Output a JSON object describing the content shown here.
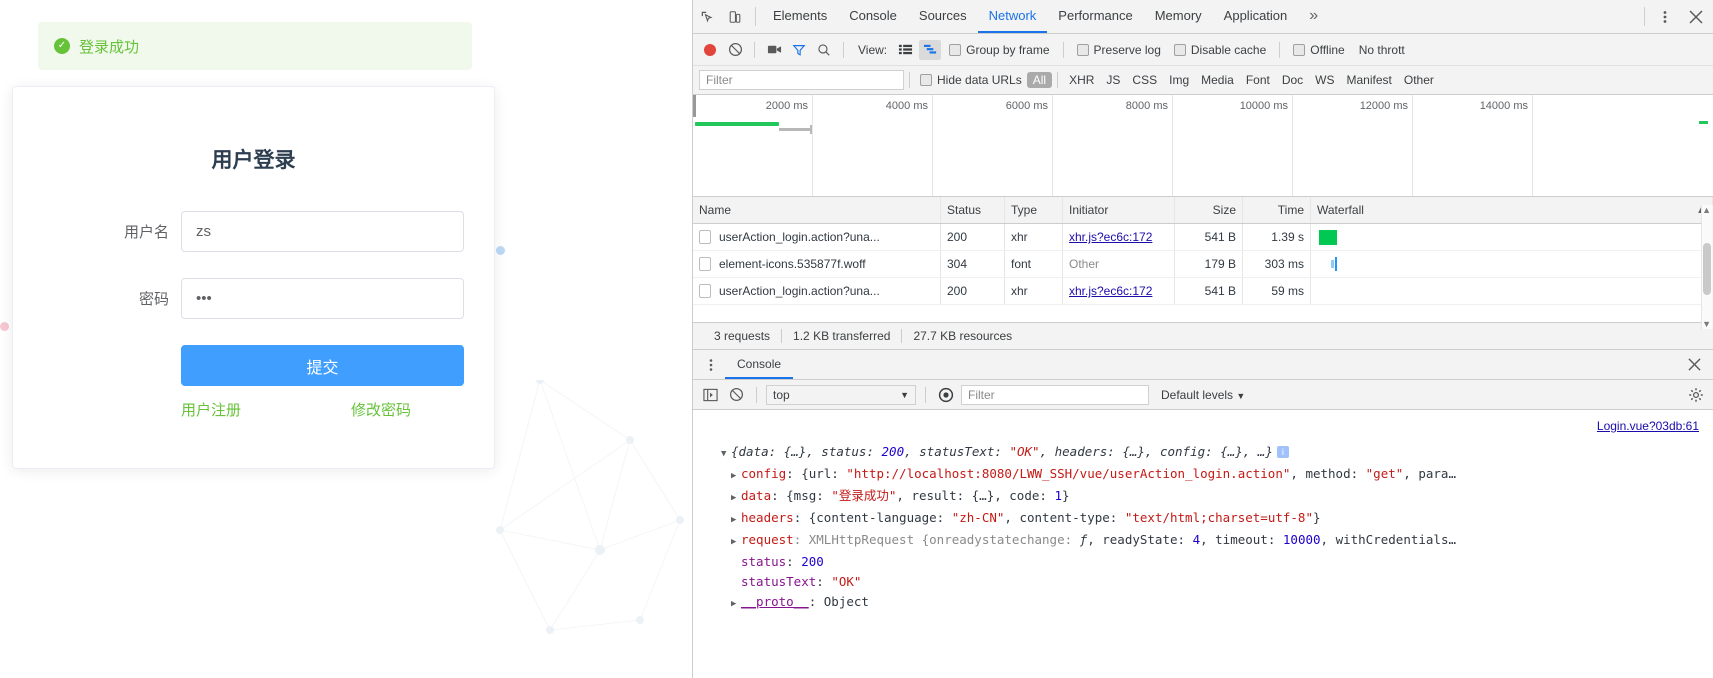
{
  "webpage": {
    "alert": {
      "icon": "check-circle-icon",
      "text": "登录成功"
    },
    "login_card": {
      "title": "用户登录",
      "fields": [
        {
          "label": "用户名",
          "value": "zs",
          "placeholder": "",
          "type": "text"
        },
        {
          "label": "密码",
          "value": "•••",
          "placeholder": "",
          "type": "password"
        }
      ],
      "submit_label": "提交",
      "links": [
        {
          "label": "用户注册"
        },
        {
          "label": "修改密码"
        }
      ]
    },
    "colors": {
      "success": "#67c23a",
      "primary": "#409eff",
      "alert_bg": "#f0f9eb"
    }
  },
  "devtools": {
    "tabs": [
      {
        "label": "Elements",
        "active": false
      },
      {
        "label": "Console",
        "active": false
      },
      {
        "label": "Sources",
        "active": false
      },
      {
        "label": "Network",
        "active": true
      },
      {
        "label": "Performance",
        "active": false
      },
      {
        "label": "Memory",
        "active": false
      },
      {
        "label": "Application",
        "active": false
      }
    ],
    "tabs_overflow": "»",
    "more_menu_icon": "kebab-menu-icon",
    "close_icon": "close-icon",
    "inspect_icon": "inspect-element-icon",
    "device_icon": "device-toolbar-icon",
    "network_toolbar": {
      "record_icon": "record-stop-icon",
      "clear_icon": "clear-no-entry-icon",
      "screenshot_icon": "camera-icon",
      "filter_icon": "funnel-icon",
      "search_icon": "search-icon",
      "view_label": "View:",
      "view_list_icon": "list-view-icon",
      "view_waterfall_icon": "waterfall-view-icon",
      "group_by_frame": "Group by frame",
      "preserve_log": "Preserve log",
      "disable_cache": "Disable cache",
      "offline": "Offline",
      "throttle": "No thrott"
    },
    "filter_bar": {
      "filter_placeholder": "Filter",
      "filter_value": "",
      "hide_data_urls": "Hide data URLs",
      "types": [
        {
          "label": "All",
          "active": true
        },
        {
          "label": "XHR",
          "active": false
        },
        {
          "label": "JS",
          "active": false
        },
        {
          "label": "CSS",
          "active": false
        },
        {
          "label": "Img",
          "active": false
        },
        {
          "label": "Media",
          "active": false
        },
        {
          "label": "Font",
          "active": false
        },
        {
          "label": "Doc",
          "active": false
        },
        {
          "label": "WS",
          "active": false
        },
        {
          "label": "Manifest",
          "active": false
        },
        {
          "label": "Other",
          "active": false
        }
      ]
    },
    "timeline": {
      "ticks": [
        "2000 ms",
        "4000 ms",
        "6000 ms",
        "8000 ms",
        "10000 ms",
        "12000 ms",
        "14000 ms"
      ]
    },
    "table": {
      "columns": [
        "Name",
        "Status",
        "Type",
        "Initiator",
        "Size",
        "Time",
        "Waterfall"
      ],
      "rows": [
        {
          "name": "userAction_login.action?una...",
          "status": "200",
          "type": "xhr",
          "initiator": "xhr.js?ec6c:172",
          "initiator_is_link": true,
          "size": "541 B",
          "time": "1.39 s"
        },
        {
          "name": "element-icons.535877f.woff",
          "status": "304",
          "type": "font",
          "initiator": "Other",
          "initiator_is_link": false,
          "size": "179 B",
          "time": "303 ms"
        },
        {
          "name": "userAction_login.action?una...",
          "status": "200",
          "type": "xhr",
          "initiator": "xhr.js?ec6c:172",
          "initiator_is_link": true,
          "size": "541 B",
          "time": "59 ms"
        }
      ]
    },
    "summary": {
      "requests": "3 requests",
      "transferred": "1.2 KB transferred",
      "resources": "27.7 KB resources"
    },
    "drawer": {
      "tab": "Console",
      "kebab_icon": "kebab-menu-icon",
      "close_icon": "close-icon",
      "toolbar": {
        "sidebar_icon": "show-sidebar-icon",
        "clear_icon": "clear-console-icon",
        "context": "top",
        "eye_icon": "live-expression-eye-icon",
        "filter_placeholder": "Filter",
        "filter_value": "",
        "levels": "Default levels",
        "settings_icon": "gear-icon"
      },
      "source_link": "Login.vue?03db:61",
      "log": {
        "line1_prefix": "{data: {…}, status: ",
        "line1_status": "200",
        "line1_mid": ", statusText: ",
        "line1_ok": "\"OK\"",
        "line1_suffix": ", headers: {…}, config: {…}, …}",
        "line1_badge": "i",
        "config_key": "config",
        "config_val_pre": ": {url: ",
        "config_url": "\"http://localhost:8080/LWW_SSH/vue/userAction_login.action\"",
        "config_val_post": ", method: ",
        "config_method": "\"get\"",
        "config_tail": ", para…",
        "data_key": "data",
        "data_pre": ": {msg: ",
        "data_msg": "\"登录成功\"",
        "data_post": ", result: {…}, code: ",
        "data_code": "1",
        "data_tail": "}",
        "headers_key": "headers",
        "headers_pre": ": {content-language: ",
        "headers_lang": "\"zh-CN\"",
        "headers_mid": ", content-type: ",
        "headers_ct": "\"text/html;charset=utf-8\"",
        "headers_tail": "}",
        "request_key": "request",
        "request_pre": ": XMLHttpRequest {onreadystatechange: ",
        "request_f": "ƒ",
        "request_mid": ", readyState: ",
        "request_rs": "4",
        "request_mid2": ", timeout: ",
        "request_timeout": "10000",
        "request_tail": ", withCredentials…",
        "status_key": "status",
        "status_val": "200",
        "statusText_key": "statusText",
        "statusText_val": "\"OK\"",
        "proto_key": "__proto__",
        "proto_val": ": Object"
      }
    }
  }
}
